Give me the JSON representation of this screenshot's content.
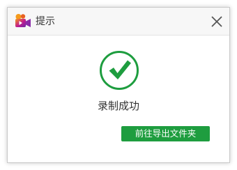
{
  "dialog": {
    "title": "提示",
    "app_icon": "video-camera-icon",
    "close_icon": "close-icon"
  },
  "main": {
    "status_icon": "check-circle-icon",
    "status_text": "录制成功",
    "export_button_label": "前往导出文件夹"
  },
  "colors": {
    "accent_green": "#1e9d3f",
    "icon_orange": "#f59a1b",
    "icon_magenta": "#c01a8f",
    "icon_purple": "#6a2aa8"
  }
}
